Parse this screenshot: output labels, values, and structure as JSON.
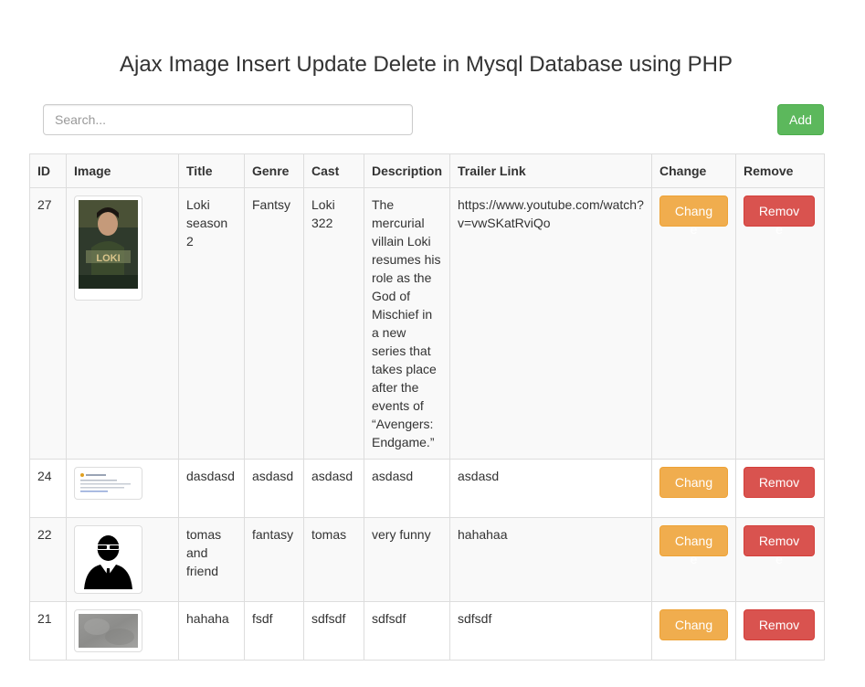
{
  "page": {
    "title": "Ajax Image Insert Update Delete in Mysql Database using PHP"
  },
  "search": {
    "placeholder": "Search...",
    "value": ""
  },
  "toolbar": {
    "add_label": "Add"
  },
  "colors": {
    "add": "#5cb85c",
    "change": "#f0ad4e",
    "remove": "#d9534f"
  },
  "table": {
    "headers": [
      "ID",
      "Image",
      "Title",
      "Genre",
      "Cast",
      "Description",
      "Trailer Link",
      "Change",
      "Remove"
    ],
    "rows": [
      {
        "id": "27",
        "image": "loki-poster",
        "title": "Loki season 2",
        "genre": "Fantsy",
        "cast": "Loki 322",
        "description": "The mercurial villain Loki resumes his role as the God of Mischief in a new series that takes place after the events of “Avengers: Endgame.”",
        "trailer": "https://www.youtube.com/watch?v=vwSKatRviQo",
        "change_label": "Change",
        "remove_label": "Remove"
      },
      {
        "id": "24",
        "image": "document-screenshot",
        "title": "dasdasd",
        "genre": "asdasd",
        "cast": "asdasd",
        "description": "asdasd",
        "trailer": "asdasd",
        "change_label": "Change",
        "remove_label": "Remove"
      },
      {
        "id": "22",
        "image": "agent-avatar",
        "title": "tomas and friend",
        "genre": "fantasy",
        "cast": "tomas",
        "description": "very funny",
        "trailer": "hahahaa",
        "change_label": "Change",
        "remove_label": "Remove"
      },
      {
        "id": "21",
        "image": "blurred-photo",
        "title": "hahaha",
        "genre": "fsdf",
        "cast": "sdfsdf",
        "description": "sdfsdf",
        "trailer": "sdfsdf",
        "change_label": "Change",
        "remove_label": "Remove"
      }
    ]
  }
}
